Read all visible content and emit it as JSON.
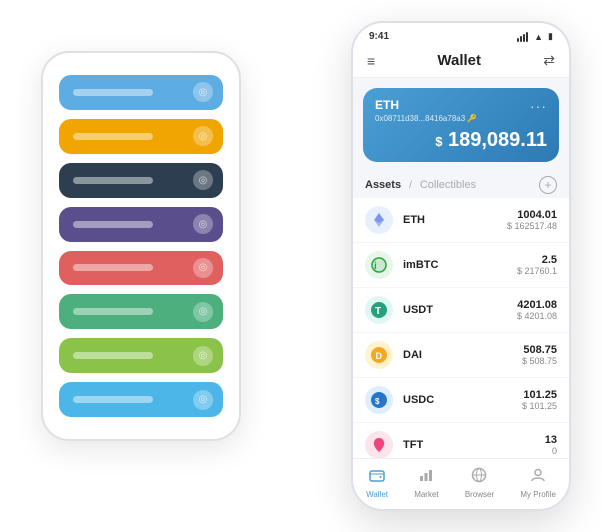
{
  "bg_phone": {
    "cards": [
      {
        "color": "blue",
        "label": ""
      },
      {
        "color": "orange",
        "label": ""
      },
      {
        "color": "dark",
        "label": ""
      },
      {
        "color": "purple",
        "label": ""
      },
      {
        "color": "red",
        "label": ""
      },
      {
        "color": "green",
        "label": ""
      },
      {
        "color": "light-green",
        "label": ""
      },
      {
        "color": "sky",
        "label": ""
      }
    ]
  },
  "phone": {
    "status_bar": {
      "time": "9:41",
      "battery": "●●●"
    },
    "header": {
      "menu_icon": "≡",
      "title": "Wallet",
      "scan_icon": "⇄"
    },
    "eth_card": {
      "symbol": "ETH",
      "address": "0x08711d38...8416a78a3  🔑",
      "more_icon": "···",
      "balance_currency": "$",
      "balance": "189,089.11"
    },
    "assets_section": {
      "tab_active": "Assets",
      "tab_slash": "/",
      "tab_inactive": "Collectibles",
      "add_icon": "+"
    },
    "assets": [
      {
        "symbol": "ETH",
        "amount": "1004.01",
        "usd": "$ 162517.48",
        "icon_char": "♦",
        "icon_class": "icon-eth"
      },
      {
        "symbol": "imBTC",
        "amount": "2.5",
        "usd": "$ 21760.1",
        "icon_char": "●",
        "icon_class": "icon-imbtc"
      },
      {
        "symbol": "USDT",
        "amount": "4201.08",
        "usd": "$ 4201.08",
        "icon_char": "T",
        "icon_class": "icon-usdt"
      },
      {
        "symbol": "DAI",
        "amount": "508.75",
        "usd": "$ 508.75",
        "icon_char": "◈",
        "icon_class": "icon-dai"
      },
      {
        "symbol": "USDC",
        "amount": "101.25",
        "usd": "$ 101.25",
        "icon_char": "$",
        "icon_class": "icon-usdc"
      },
      {
        "symbol": "TFT",
        "amount": "13",
        "usd": "0",
        "icon_char": "🌿",
        "icon_class": "icon-tft"
      }
    ],
    "bottom_nav": [
      {
        "label": "Wallet",
        "icon": "◎",
        "active": true
      },
      {
        "label": "Market",
        "icon": "📊",
        "active": false
      },
      {
        "label": "Browser",
        "icon": "🌐",
        "active": false
      },
      {
        "label": "My Profile",
        "icon": "👤",
        "active": false
      }
    ]
  }
}
